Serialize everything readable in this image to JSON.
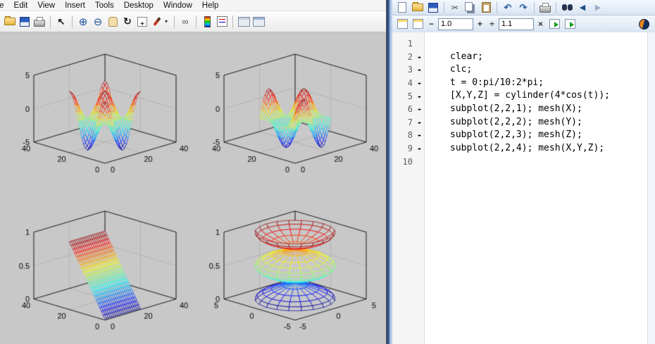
{
  "colors": {
    "figure_background": "#c8c8c8",
    "grid_line": "#8a8a8a",
    "box_edge": "#222222",
    "divider_blue": "#2b4a7d",
    "colormap": "jet"
  },
  "figure": {
    "menu": [
      "File",
      "Edit",
      "View",
      "Insert",
      "Tools",
      "Desktop",
      "Window",
      "Help"
    ],
    "toolbar_icons": [
      "open",
      "save",
      "print",
      "edit-plot-cursor",
      "zoom-in",
      "zoom-out",
      "pan",
      "rotate-3d",
      "data-cursor",
      "brush",
      "brush-dropdown",
      "link-plot",
      "insert-colorbar",
      "insert-legend",
      "hide-plot-tools",
      "show-plot-tools"
    ]
  },
  "editor": {
    "toolbar_icons": [
      "new-file",
      "open",
      "save",
      "cut",
      "copy",
      "paste",
      "undo",
      "redo",
      "print",
      "find",
      "back",
      "forward"
    ],
    "cell_toolbar": {
      "icons": [
        "insert-cell",
        "insert-cell-divider",
        "evaluate-cell",
        "evaluate-cell-advance",
        "code-analyzer-indicator"
      ],
      "decrement_label": "−",
      "value1": "1.0",
      "increment_label": "+",
      "divide_label": "÷",
      "value2": "1.1",
      "multiply_label": "×"
    },
    "lines": [
      {
        "num": "1",
        "marker": "",
        "code": ""
      },
      {
        "num": "2",
        "marker": "-",
        "code": "clear;"
      },
      {
        "num": "3",
        "marker": "-",
        "code": "clc;"
      },
      {
        "num": "4",
        "marker": "-",
        "code": "t = 0:pi/10:2*pi;"
      },
      {
        "num": "5",
        "marker": "-",
        "code": "[X,Y,Z] = cylinder(4*cos(t));"
      },
      {
        "num": "6",
        "marker": "-",
        "code": "subplot(2,2,1); mesh(X);"
      },
      {
        "num": "7",
        "marker": "-",
        "code": "subplot(2,2,2); mesh(Y);"
      },
      {
        "num": "8",
        "marker": "-",
        "code": "subplot(2,2,3); mesh(Z);"
      },
      {
        "num": "9",
        "marker": "-",
        "code": "subplot(2,2,4); mesh(X,Y,Z);"
      },
      {
        "num": "10",
        "marker": "",
        "code": ""
      }
    ]
  },
  "chart_data": [
    {
      "id": "plot-0",
      "type": "mesh",
      "command": "subplot(2,2,1); mesh(X)",
      "gen": "X",
      "formula": "Z(i,j) = 4*cos(t_i)*cos(theta_j); t = 0:pi/10:2*pi; theta = 0:pi/10:2*pi; plotted over column/row index 1..21",
      "grid_size": [
        21,
        21
      ],
      "colormap": "jet",
      "grid": true,
      "xlim": [
        0,
        40
      ],
      "ylim": [
        0,
        40
      ],
      "zlim": [
        -5,
        5
      ],
      "xticks": [
        0,
        20,
        40
      ],
      "yticks": [
        0,
        20,
        40
      ],
      "zticks": [
        -5,
        0,
        5
      ],
      "data_x_range": [
        1,
        21
      ],
      "data_y_range": [
        1,
        21
      ],
      "data_z_range": [
        -4,
        4
      ]
    },
    {
      "id": "plot-1",
      "type": "mesh",
      "command": "subplot(2,2,2); mesh(Y)",
      "gen": "Y",
      "formula": "Z(i,j) = 4*cos(t_i)*sin(theta_j); t = 0:pi/10:2*pi; theta = 0:pi/10:2*pi; plotted over column/row index 1..21",
      "grid_size": [
        21,
        21
      ],
      "colormap": "jet",
      "grid": true,
      "xlim": [
        0,
        40
      ],
      "ylim": [
        0,
        40
      ],
      "zlim": [
        -5,
        5
      ],
      "xticks": [
        0,
        20,
        40
      ],
      "yticks": [
        0,
        20,
        40
      ],
      "zticks": [
        -5,
        0,
        5
      ],
      "data_x_range": [
        1,
        21
      ],
      "data_y_range": [
        1,
        21
      ],
      "data_z_range": [
        -4,
        4
      ]
    },
    {
      "id": "plot-2",
      "type": "mesh",
      "command": "subplot(2,2,3); mesh(Z)",
      "gen": "Z",
      "formula": "Z(i,j) = (i-1)/20, a linear ramp 0..1 along rows; plotted over column/row index 1..21",
      "grid_size": [
        21,
        21
      ],
      "colormap": "jet",
      "grid": true,
      "xlim": [
        0,
        40
      ],
      "ylim": [
        0,
        40
      ],
      "zlim": [
        0,
        1
      ],
      "xticks": [
        0,
        20,
        40
      ],
      "yticks": [
        0,
        20,
        40
      ],
      "zticks": [
        0,
        0.5,
        1
      ],
      "data_x_range": [
        1,
        21
      ],
      "data_y_range": [
        1,
        21
      ],
      "data_z_range": [
        0,
        1
      ]
    },
    {
      "id": "plot-3",
      "type": "mesh",
      "command": "subplot(2,2,4); mesh(X,Y,Z)",
      "gen": "XYZ",
      "formula": "x = 4*cos(t_i)*cos(theta_j); y = 4*cos(t_i)*sin(theta_j); z = (i-1)/20; cylinder of radius 4*cos(t), three stacked lobes (blue bottom, green middle, red top)",
      "grid_size": [
        21,
        21
      ],
      "colormap": "jet",
      "grid": true,
      "xlim": [
        -5,
        5
      ],
      "ylim": [
        -5,
        5
      ],
      "zlim": [
        0,
        1
      ],
      "xticks": [
        -5,
        0,
        5
      ],
      "yticks": [
        -5,
        0,
        5
      ],
      "zticks": [
        0,
        0.5,
        1
      ],
      "data_x_range": [
        -4,
        4
      ],
      "data_y_range": [
        -4,
        4
      ],
      "data_z_range": [
        0,
        1
      ]
    }
  ]
}
